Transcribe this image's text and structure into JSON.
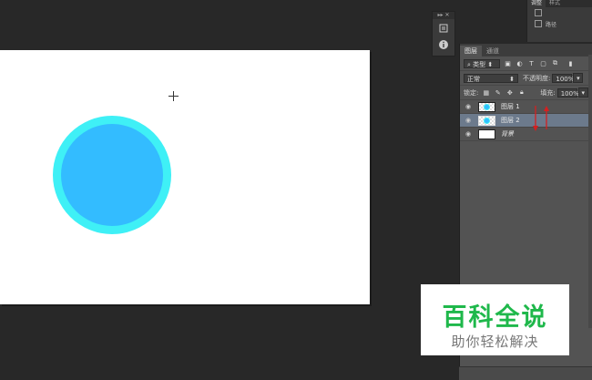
{
  "top_panel": {
    "tabs": [
      "调整",
      "样式"
    ],
    "items": [
      "",
      "路径"
    ]
  },
  "mini_strip": {
    "header": "▸▸ ✕"
  },
  "layers_panel": {
    "tabs": [
      "图层",
      "通道"
    ],
    "filter_label": "类型",
    "blend_mode": "正常",
    "opacity_label": "不透明度:",
    "opacity_value": "100%",
    "lock_label": "锁定:",
    "fill_label": "填充:",
    "fill_value": "100%",
    "layers": [
      {
        "name": "图层 1",
        "selected": false
      },
      {
        "name": "图层 2",
        "selected": true
      },
      {
        "name": "背景",
        "selected": false
      }
    ]
  },
  "canvas": {
    "outer_color": "#3ff0f6",
    "inner_color": "#33bcff"
  },
  "watermark": {
    "title": "百科全说",
    "subtitle": "助你轻松解决"
  }
}
